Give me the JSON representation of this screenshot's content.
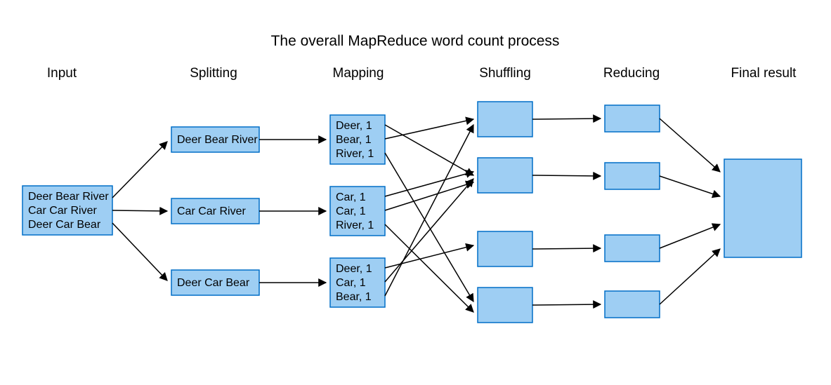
{
  "title": "The overall MapReduce word count process",
  "columns": {
    "input": "Input",
    "split": "Splitting",
    "map": "Mapping",
    "shuffle": "Shuffling",
    "reduce": "Reducing",
    "result": "Final result"
  },
  "input_lines": [
    "Deer Bear River",
    "Car Car River",
    "Deer Car Bear"
  ],
  "splits": [
    "Deer Bear River",
    "Car Car River",
    "Deer Car Bear"
  ],
  "map_out": [
    [
      "Deer, 1",
      "Bear, 1",
      "River, 1"
    ],
    [
      "Car, 1",
      "Car, 1",
      "River, 1"
    ],
    [
      "Deer, 1",
      "Car, 1",
      "Bear, 1"
    ]
  ],
  "notes": {
    "shuffle_boxes": 4,
    "reduce_boxes": 4
  }
}
